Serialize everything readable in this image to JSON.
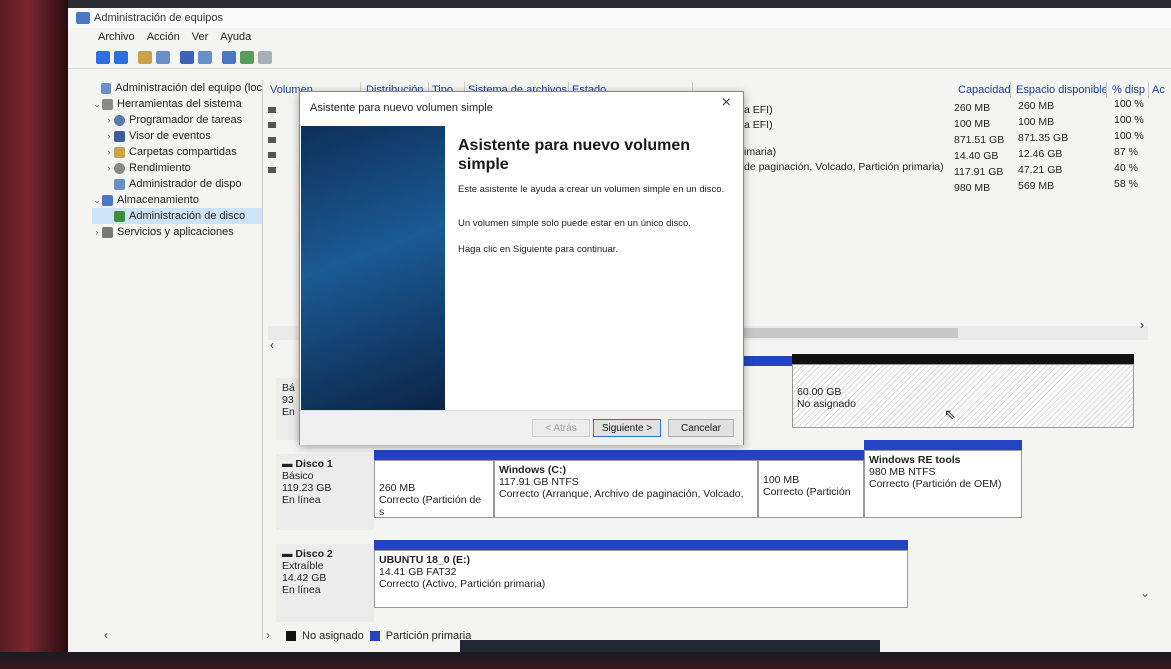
{
  "window": {
    "title": "Administración de equipos"
  },
  "menu": [
    "Archivo",
    "Acción",
    "Ver",
    "Ayuda"
  ],
  "tree": [
    {
      "label": "Administración del equipo (loc",
      "indent": 0,
      "caret": ""
    },
    {
      "label": "Herramientas del sistema",
      "indent": 1,
      "caret": "v"
    },
    {
      "label": "Programador de tareas",
      "indent": 2,
      "caret": ">"
    },
    {
      "label": "Visor de eventos",
      "indent": 2,
      "caret": ">"
    },
    {
      "label": "Carpetas compartidas",
      "indent": 2,
      "caret": ">"
    },
    {
      "label": "Rendimiento",
      "indent": 2,
      "caret": ">"
    },
    {
      "label": "Administrador de dispo",
      "indent": 2,
      "caret": ""
    },
    {
      "label": "Almacenamiento",
      "indent": 1,
      "caret": "v"
    },
    {
      "label": "Administración de disco",
      "indent": 2,
      "caret": ""
    },
    {
      "label": "Servicios y aplicaciones",
      "indent": 1,
      "caret": ">"
    }
  ],
  "columns": {
    "volumen": "Volumen",
    "distribucion": "Distribución",
    "tipo": "Tipo",
    "sistema": "Sistema de archivos",
    "estado": "Estado",
    "capacidad": "Capacidad",
    "espacio": "Espacio disponible",
    "pct": "% disp",
    "ac": "Ac"
  },
  "rows_status": [
    "a EFI)",
    "a EFI)",
    "",
    "imaria)",
    "de paginación, Volcado, Partición primaria)",
    ""
  ],
  "rows_capacity": [
    "260 MB",
    "100 MB",
    "871.51 GB",
    "14.40 GB",
    "117.91 GB",
    "980 MB"
  ],
  "rows_free": [
    "260 MB",
    "100 MB",
    "871.35 GB",
    "12.46 GB",
    "47.21 GB",
    "569 MB"
  ],
  "rows_pct": [
    "100 %",
    "100 %",
    "100 %",
    "87 %",
    "40 %",
    "58 %"
  ],
  "disk0_partial": {
    "l1": "Bá",
    "l2": "93",
    "l3": "En"
  },
  "unallocated": {
    "size": "60.00 GB",
    "label": "No asignado"
  },
  "disk1": {
    "name": "Disco 1",
    "type": "Básico",
    "size": "119.23 GB",
    "state": "En línea",
    "parts": [
      {
        "title": "",
        "l1": "260 MB",
        "l2": "Correcto (Partición de s"
      },
      {
        "title": "Windows (C:)",
        "l1": "117.91 GB NTFS",
        "l2": "Correcto (Arranque, Archivo de paginación, Volcado,"
      },
      {
        "title": "",
        "l1": "100 MB",
        "l2": "Correcto (Partición"
      },
      {
        "title": "Windows RE tools",
        "l1": "980 MB NTFS",
        "l2": "Correcto (Partición de OEM)"
      }
    ]
  },
  "disk2": {
    "name": "Disco 2",
    "type": "Extraíble",
    "size": "14.42 GB",
    "state": "En línea",
    "part": {
      "title": "UBUNTU 18_0  (E:)",
      "l1": "14.41 GB FAT32",
      "l2": "Correcto (Activo, Partición primaria)"
    }
  },
  "legend": {
    "unallocated": "No asignado",
    "primary": "Partición primaria"
  },
  "dialog": {
    "title": "Asistente para nuevo volumen simple",
    "heading": "Asistente para nuevo volumen simple",
    "p1": "Este asistente le ayuda a crear un volumen simple en un disco.",
    "p2": "Un volumen simple solo puede estar en un único disco.",
    "p3": "Haga clic en Siguiente para continuar.",
    "back": "< Atrás",
    "next": "Siguiente >",
    "cancel": "Cancelar"
  },
  "colors": {
    "primary_partition": "#2343c4",
    "unallocated": "#111111",
    "accent": "#2d6ee0"
  }
}
